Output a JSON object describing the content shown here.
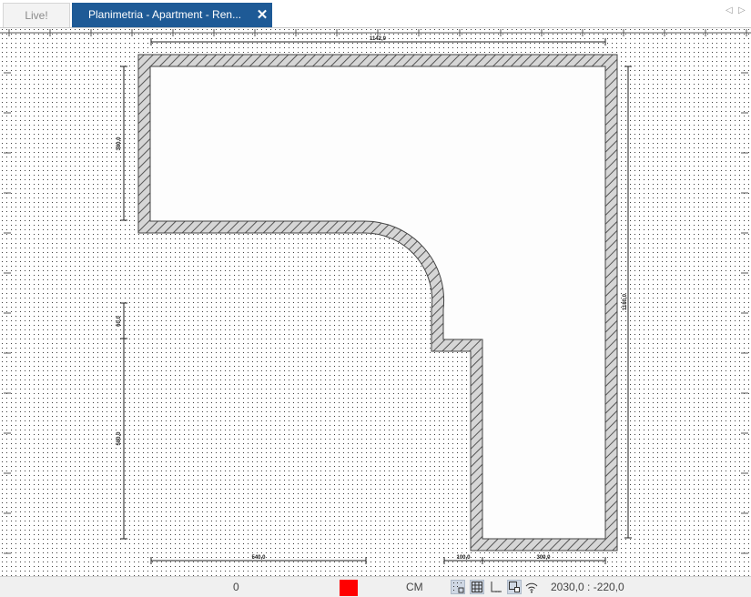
{
  "tabs": [
    {
      "label": "Live!",
      "active": false
    },
    {
      "label": "Planimetria - Apartment - Ren...",
      "active": true
    }
  ],
  "nav_icons": [
    "chevron-left-icon",
    "chevron-right-icon"
  ],
  "drawing": {
    "dimensions": {
      "top_width": "1142,0",
      "left_upper_height": "380,0",
      "right_height": "1180,0",
      "left_mid_height": "60,0",
      "left_lower_height": "580,0",
      "bottom_left_width": "540,0",
      "bottom_step_width": "100,0",
      "bottom_right_width": "300,0"
    },
    "wall_color": "#555555",
    "hatch_color": "#a8a8a8"
  },
  "status": {
    "value": "0",
    "color_swatch": "#ff0000",
    "unit": "CM",
    "icons": [
      "snap-grid-icon",
      "grid-icon",
      "ortho-icon",
      "object-snap-icon",
      "wireless-icon"
    ],
    "coordinates": "2030,0 : -220,0"
  }
}
